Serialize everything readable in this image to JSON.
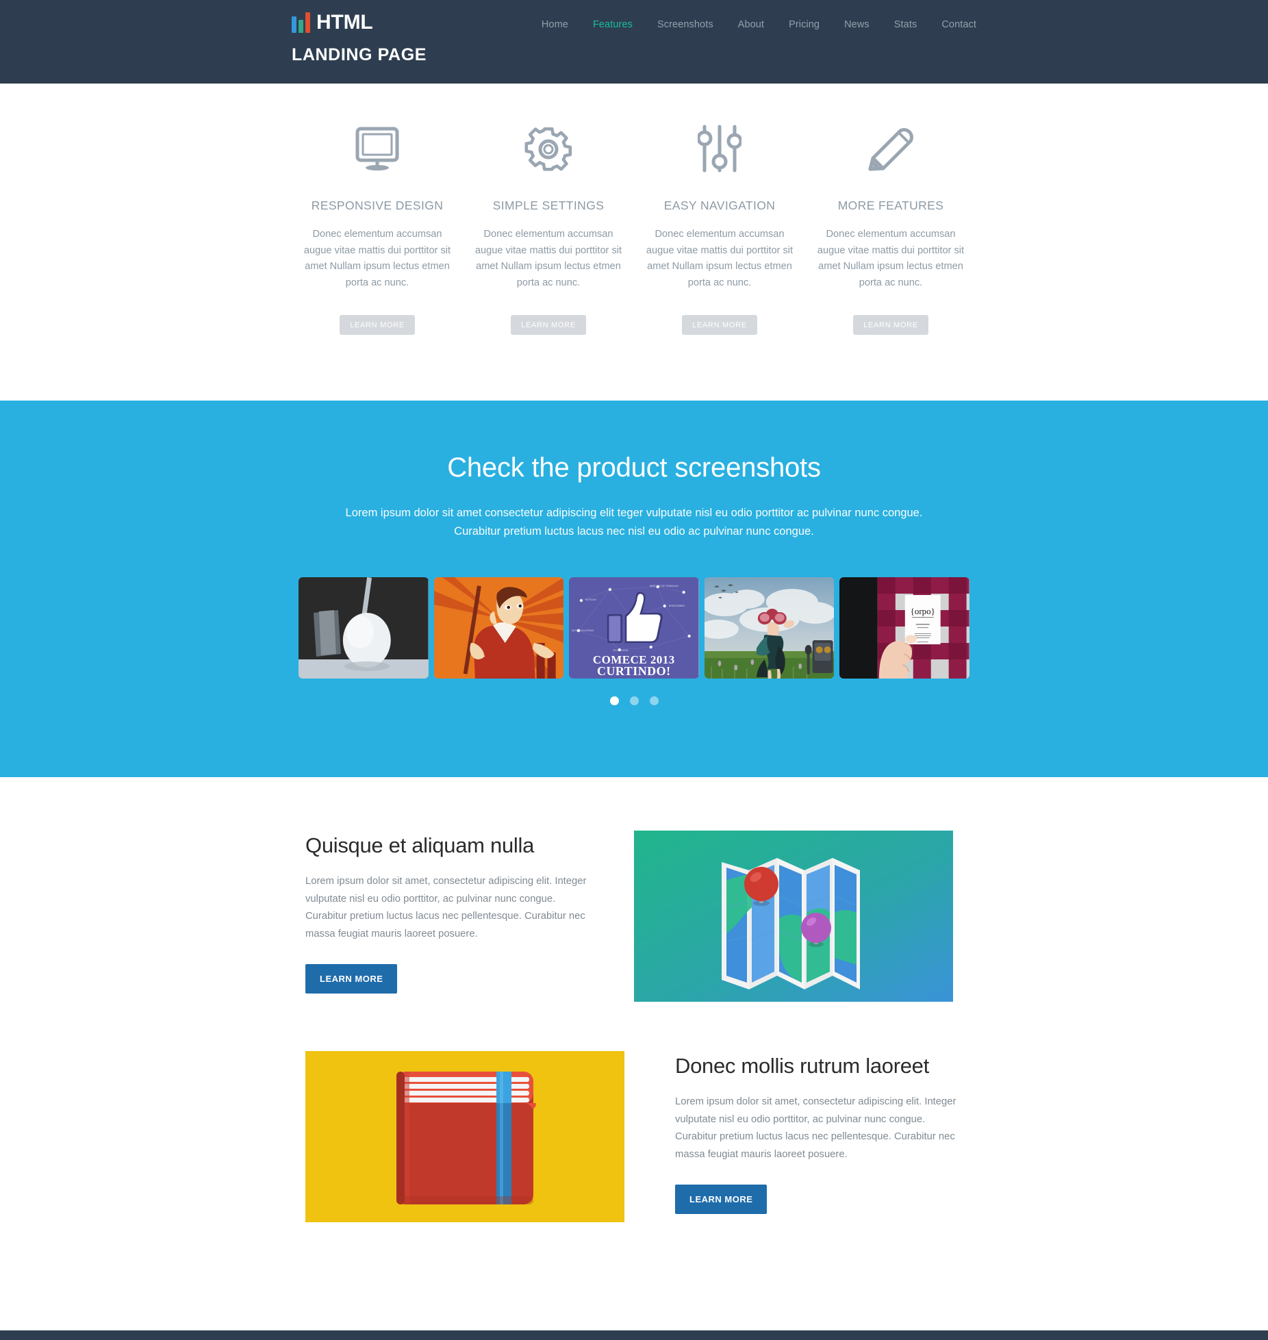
{
  "colors": {
    "header_bg": "#2e3e50",
    "accent_blue": "#29b0e0",
    "accent_teal": "#1abc9c",
    "button_primary": "#1f6cab",
    "button_muted": "#d5d8dc",
    "muted_text": "#8d9aa5"
  },
  "header": {
    "brand_name": "HTML",
    "brand_subtitle": "LANDING PAGE",
    "logo_icon": "bar-chart-logo-icon",
    "nav": [
      {
        "label": "Home",
        "active": false
      },
      {
        "label": "Features",
        "active": true
      },
      {
        "label": "Screenshots",
        "active": false
      },
      {
        "label": "About",
        "active": false
      },
      {
        "label": "Pricing",
        "active": false
      },
      {
        "label": "News",
        "active": false
      },
      {
        "label": "Stats",
        "active": false
      },
      {
        "label": "Contact",
        "active": false
      }
    ]
  },
  "features": {
    "items": [
      {
        "icon": "monitor-icon",
        "title": "RESPONSIVE DESIGN",
        "text": "Donec elementum accumsan augue vitae mattis dui porttitor sit amet Nullam ipsum lectus etmen porta ac nunc.",
        "button": "LEARN MORE"
      },
      {
        "icon": "gear-icon",
        "title": "SIMPLE SETTINGS",
        "text": "Donec elementum accumsan augue vitae mattis dui porttitor sit amet Nullam ipsum lectus etmen porta ac nunc.",
        "button": "LEARN MORE"
      },
      {
        "icon": "sliders-icon",
        "title": "EASY NAVIGATION",
        "text": "Donec elementum accumsan augue vitae mattis dui porttitor sit amet Nullam ipsum lectus etmen porta ac nunc.",
        "button": "LEARN MORE"
      },
      {
        "icon": "pencil-icon",
        "title": "MORE FEATURES",
        "text": "Donec elementum accumsan augue vitae mattis dui porttitor sit amet Nullam ipsum lectus etmen porta ac nunc.",
        "button": "LEARN MORE"
      }
    ]
  },
  "screenshots": {
    "title": "Check the product screenshots",
    "subtitle_line1": "Lorem ipsum dolor sit amet consectetur adipiscing elit teger vulputate nisl eu odio porttitor ac pulvinar nunc congue.",
    "subtitle_line2": "Curabitur pretium luctus lacus nec nisl eu odio ac pulvinar nunc congue.",
    "thumbnails": [
      {
        "name": "golf-ball-photo",
        "caption": ""
      },
      {
        "name": "man-with-flag-illustration",
        "caption": ""
      },
      {
        "name": "thumbs-up-poster",
        "caption_line1": "COMECE 2013",
        "caption_line2": "CURTINDO!"
      },
      {
        "name": "woman-in-field-photo",
        "caption": ""
      },
      {
        "name": "hand-holding-business-card-photo",
        "caption": "{orpo}"
      }
    ],
    "dots": [
      {
        "active": true
      },
      {
        "active": false
      },
      {
        "active": false
      }
    ]
  },
  "content_blocks": [
    {
      "title": "Quisque et aliquam nulla",
      "text": "Lorem ipsum dolor sit amet, consectetur adipiscing elit. Integer vulputate nisl eu odio porttitor, ac pulvinar nunc congue. Curabitur pretium luctus lacus nec pellentesque. Curabitur nec massa feugiat mauris laoreet posuere.",
      "button": "LEARN MORE",
      "media": "folded-map-with-pins-illustration",
      "media_side": "right"
    },
    {
      "title": "Donec mollis rutrum laoreet",
      "text": "Lorem ipsum dolor sit amet, consectetur adipiscing elit. Integer vulputate nisl eu odio porttitor, ac pulvinar nunc congue. Curabitur pretium luctus lacus nec pellentesque. Curabitur nec massa feugiat mauris laoreet posuere.",
      "button": "LEARN MORE",
      "media": "red-notebook-illustration",
      "media_side": "left"
    }
  ]
}
